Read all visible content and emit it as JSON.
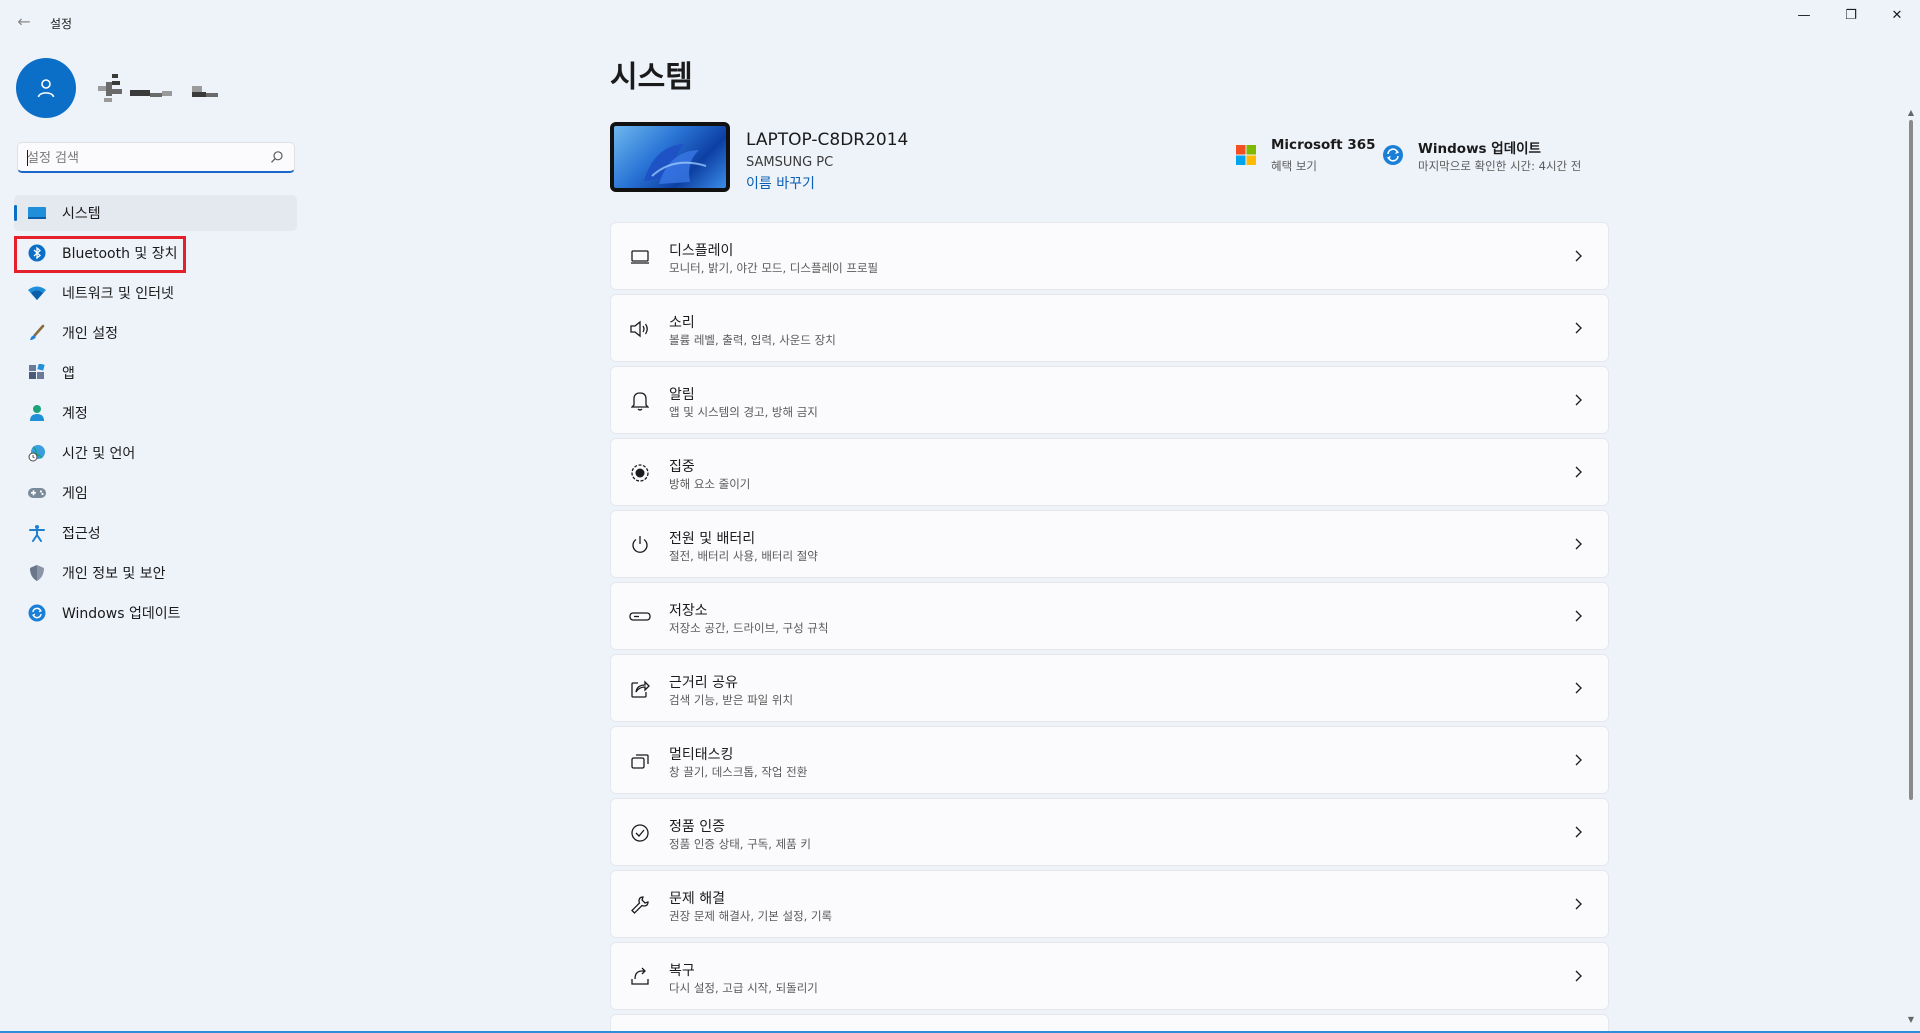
{
  "window": {
    "title": "설정",
    "back_glyph": "←",
    "minimize_glyph": "—",
    "maximize_glyph": "❐",
    "close_glyph": "✕"
  },
  "search": {
    "placeholder": "설정 검색"
  },
  "sidebar": {
    "items": [
      {
        "label": "시스템",
        "icon": "system-icon",
        "selected": true
      },
      {
        "label": "Bluetooth 및 장치",
        "icon": "bluetooth-icon",
        "selected": false
      },
      {
        "label": "네트워크 및 인터넷",
        "icon": "wifi-icon",
        "selected": false
      },
      {
        "label": "개인 설정",
        "icon": "paintbrush-icon",
        "selected": false
      },
      {
        "label": "앱",
        "icon": "apps-icon",
        "selected": false
      },
      {
        "label": "계정",
        "icon": "account-icon",
        "selected": false
      },
      {
        "label": "시간 및 언어",
        "icon": "globe-clock-icon",
        "selected": false
      },
      {
        "label": "게임",
        "icon": "gamepad-icon",
        "selected": false
      },
      {
        "label": "접근성",
        "icon": "accessibility-icon",
        "selected": false
      },
      {
        "label": "개인 정보 및 보안",
        "icon": "shield-icon",
        "selected": false
      },
      {
        "label": "Windows 업데이트",
        "icon": "windows-update-icon",
        "selected": false
      }
    ]
  },
  "main": {
    "page_title": "시스템",
    "device": {
      "name": "LAPTOP-C8DR2014",
      "model": "SAMSUNG PC",
      "rename_label": "이름 바꾸기"
    },
    "promos": {
      "microsoft365": {
        "title": "Microsoft 365",
        "subtitle": "혜택 보기"
      },
      "windows_update": {
        "title": "Windows 업데이트",
        "subtitle": "마지막으로 확인한 시간: 4시간 전"
      }
    },
    "cards": [
      {
        "title": "디스플레이",
        "subtitle": "모니터, 밝기, 야간 모드, 디스플레이 프로필",
        "icon": "display-icon"
      },
      {
        "title": "소리",
        "subtitle": "볼륨 레벨, 출력, 입력, 사운드 장치",
        "icon": "speaker-icon"
      },
      {
        "title": "알림",
        "subtitle": "앱 및 시스템의 경고, 방해 금지",
        "icon": "bell-icon"
      },
      {
        "title": "집중",
        "subtitle": "방해 요소 줄이기",
        "icon": "focus-icon"
      },
      {
        "title": "전원 및 배터리",
        "subtitle": "절전, 배터리 사용, 배터리 절약",
        "icon": "power-icon"
      },
      {
        "title": "저장소",
        "subtitle": "저장소 공간, 드라이브, 구성 규칙",
        "icon": "storage-icon"
      },
      {
        "title": "근거리 공유",
        "subtitle": "검색 기능, 받은 파일 위치",
        "icon": "share-icon"
      },
      {
        "title": "멀티태스킹",
        "subtitle": "창 끌기, 데스크톱, 작업 전환",
        "icon": "multitask-icon"
      },
      {
        "title": "정품 인증",
        "subtitle": "정품 인증 상태, 구독, 제품 키",
        "icon": "activation-check-icon"
      },
      {
        "title": "문제 해결",
        "subtitle": "권장 문제 해결사, 기본 설정, 기록",
        "icon": "wrench-icon"
      },
      {
        "title": "복구",
        "subtitle": "다시 설정, 고급 시작, 되돌리기",
        "icon": "recovery-icon"
      }
    ],
    "chevron_glyph": "›"
  },
  "colors": {
    "accent": "#0b6fc7",
    "highlight_box": "#e5202a",
    "background": "#eef2f9",
    "card": "#fbfbfd"
  }
}
